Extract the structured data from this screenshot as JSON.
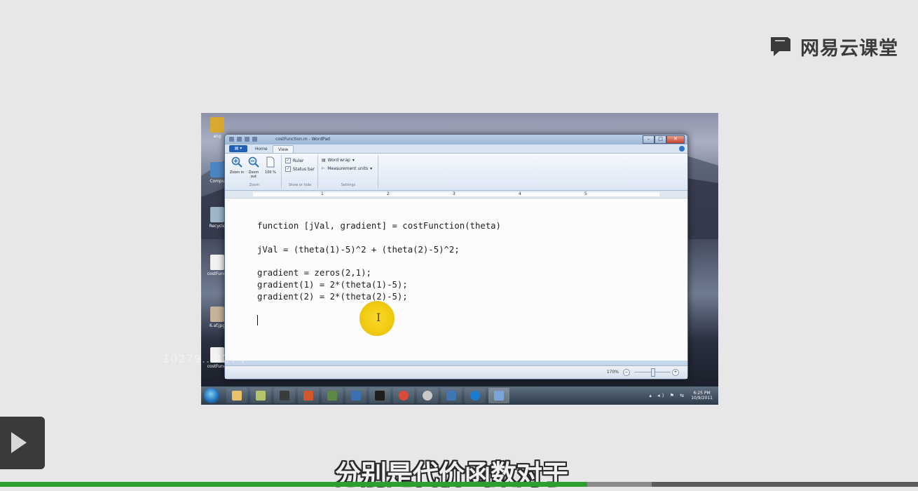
{
  "brand": {
    "name": "网易云课堂"
  },
  "video_overlay": {
    "user_id_watermark": "10279...4274"
  },
  "desktop": {
    "icons": [
      {
        "label": "ang"
      },
      {
        "label": "Compu"
      },
      {
        "label": "Recycle"
      },
      {
        "label": "costFunct"
      },
      {
        "label": "6.af.jpg"
      },
      {
        "label": "costFunct"
      }
    ]
  },
  "wordpad": {
    "title": "costFunction.m - WordPad",
    "tabs": [
      {
        "label": "Home"
      },
      {
        "label": "View"
      }
    ],
    "ribbon": {
      "zoom_group": {
        "label": "Zoom",
        "zoom_in": "Zoom in",
        "zoom_out": "Zoom out",
        "hundred": "100 %"
      },
      "show_hide_group": {
        "label": "Show or hide",
        "ruler": "Ruler",
        "status_bar": "Status bar"
      },
      "settings_group": {
        "label": "Settings",
        "word_wrap": "Word wrap",
        "measurement_units": "Measurement units"
      }
    },
    "ruler_numbers": [
      "1",
      "2",
      "3",
      "4",
      "5"
    ],
    "document_lines": [
      "function [jVal, gradient] = costFunction(theta)",
      "jVal = (theta(1)-5)^2 + (theta(2)-5)^2;",
      "gradient = zeros(2,1);",
      "gradient(1) = 2*(theta(1)-5);",
      "gradient(2) = 2*(theta(2)-5);"
    ],
    "status": {
      "zoom": "170%"
    }
  },
  "taskbar": {
    "time": "6:25 PM",
    "date": "10/9/2011"
  },
  "subtitle": "分别是代价函数对于",
  "progress": {
    "played_fraction": 0.64,
    "buffered_fraction": 0.71
  }
}
